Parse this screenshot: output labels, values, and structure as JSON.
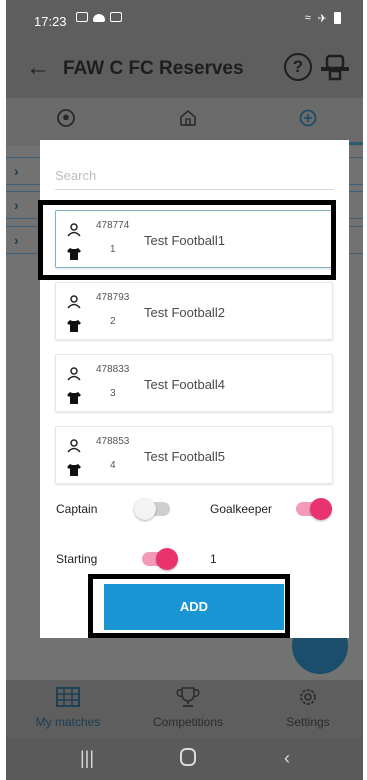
{
  "status_bar": {
    "time": "17:23"
  },
  "app_bar": {
    "title": "FAW C FC Reserves",
    "help_label": "?"
  },
  "dialog": {
    "search_placeholder": "Search",
    "players": [
      {
        "id": "478774",
        "number": "1",
        "name": "Test Football1",
        "selected": true
      },
      {
        "id": "478793",
        "number": "2",
        "name": "Test Football2",
        "selected": false
      },
      {
        "id": "478833",
        "number": "3",
        "name": "Test Football4",
        "selected": false
      },
      {
        "id": "478853",
        "number": "4",
        "name": "Test Football5",
        "selected": false
      }
    ],
    "options": {
      "captain_label": "Captain",
      "captain_on": false,
      "goalkeeper_label": "Goalkeeper",
      "goalkeeper_on": true,
      "starting_label": "Starting",
      "starting_on": true,
      "starting_count": "1"
    },
    "add_label": "ADD"
  },
  "bottom_nav": {
    "items": [
      {
        "label": "My matches",
        "icon": "calendar-grid-icon",
        "active": true
      },
      {
        "label": "Competitions",
        "icon": "trophy-icon",
        "active": false
      },
      {
        "label": "Settings",
        "icon": "gear-icon",
        "active": false
      }
    ]
  },
  "colors": {
    "accent_pink": "#e8336f",
    "add_button": "#1a96d4",
    "nav_active": "#1a3e55"
  }
}
